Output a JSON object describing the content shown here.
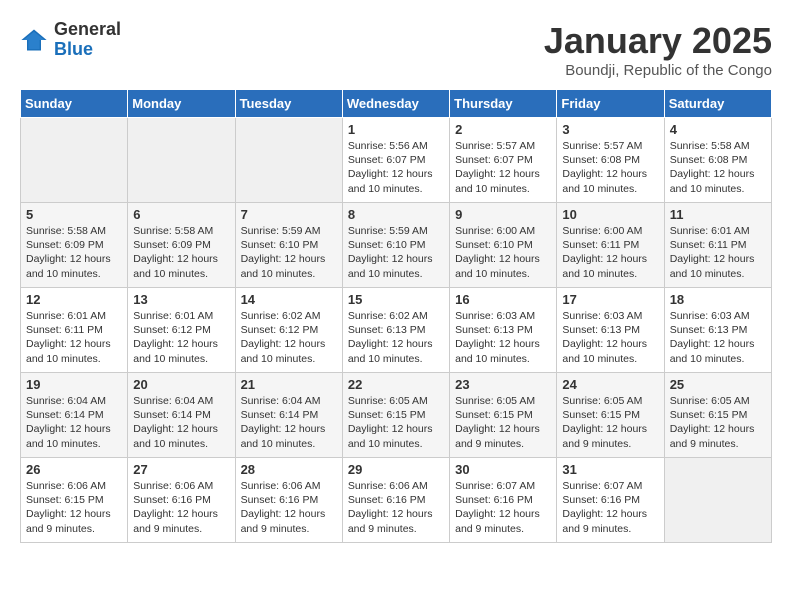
{
  "header": {
    "logo_general": "General",
    "logo_blue": "Blue",
    "month_title": "January 2025",
    "location": "Boundji, Republic of the Congo"
  },
  "days_of_week": [
    "Sunday",
    "Monday",
    "Tuesday",
    "Wednesday",
    "Thursday",
    "Friday",
    "Saturday"
  ],
  "weeks": [
    [
      {
        "day": "",
        "info": ""
      },
      {
        "day": "",
        "info": ""
      },
      {
        "day": "",
        "info": ""
      },
      {
        "day": "1",
        "info": "Sunrise: 5:56 AM\nSunset: 6:07 PM\nDaylight: 12 hours and 10 minutes."
      },
      {
        "day": "2",
        "info": "Sunrise: 5:57 AM\nSunset: 6:07 PM\nDaylight: 12 hours and 10 minutes."
      },
      {
        "day": "3",
        "info": "Sunrise: 5:57 AM\nSunset: 6:08 PM\nDaylight: 12 hours and 10 minutes."
      },
      {
        "day": "4",
        "info": "Sunrise: 5:58 AM\nSunset: 6:08 PM\nDaylight: 12 hours and 10 minutes."
      }
    ],
    [
      {
        "day": "5",
        "info": "Sunrise: 5:58 AM\nSunset: 6:09 PM\nDaylight: 12 hours and 10 minutes."
      },
      {
        "day": "6",
        "info": "Sunrise: 5:58 AM\nSunset: 6:09 PM\nDaylight: 12 hours and 10 minutes."
      },
      {
        "day": "7",
        "info": "Sunrise: 5:59 AM\nSunset: 6:10 PM\nDaylight: 12 hours and 10 minutes."
      },
      {
        "day": "8",
        "info": "Sunrise: 5:59 AM\nSunset: 6:10 PM\nDaylight: 12 hours and 10 minutes."
      },
      {
        "day": "9",
        "info": "Sunrise: 6:00 AM\nSunset: 6:10 PM\nDaylight: 12 hours and 10 minutes."
      },
      {
        "day": "10",
        "info": "Sunrise: 6:00 AM\nSunset: 6:11 PM\nDaylight: 12 hours and 10 minutes."
      },
      {
        "day": "11",
        "info": "Sunrise: 6:01 AM\nSunset: 6:11 PM\nDaylight: 12 hours and 10 minutes."
      }
    ],
    [
      {
        "day": "12",
        "info": "Sunrise: 6:01 AM\nSunset: 6:11 PM\nDaylight: 12 hours and 10 minutes."
      },
      {
        "day": "13",
        "info": "Sunrise: 6:01 AM\nSunset: 6:12 PM\nDaylight: 12 hours and 10 minutes."
      },
      {
        "day": "14",
        "info": "Sunrise: 6:02 AM\nSunset: 6:12 PM\nDaylight: 12 hours and 10 minutes."
      },
      {
        "day": "15",
        "info": "Sunrise: 6:02 AM\nSunset: 6:13 PM\nDaylight: 12 hours and 10 minutes."
      },
      {
        "day": "16",
        "info": "Sunrise: 6:03 AM\nSunset: 6:13 PM\nDaylight: 12 hours and 10 minutes."
      },
      {
        "day": "17",
        "info": "Sunrise: 6:03 AM\nSunset: 6:13 PM\nDaylight: 12 hours and 10 minutes."
      },
      {
        "day": "18",
        "info": "Sunrise: 6:03 AM\nSunset: 6:13 PM\nDaylight: 12 hours and 10 minutes."
      }
    ],
    [
      {
        "day": "19",
        "info": "Sunrise: 6:04 AM\nSunset: 6:14 PM\nDaylight: 12 hours and 10 minutes."
      },
      {
        "day": "20",
        "info": "Sunrise: 6:04 AM\nSunset: 6:14 PM\nDaylight: 12 hours and 10 minutes."
      },
      {
        "day": "21",
        "info": "Sunrise: 6:04 AM\nSunset: 6:14 PM\nDaylight: 12 hours and 10 minutes."
      },
      {
        "day": "22",
        "info": "Sunrise: 6:05 AM\nSunset: 6:15 PM\nDaylight: 12 hours and 10 minutes."
      },
      {
        "day": "23",
        "info": "Sunrise: 6:05 AM\nSunset: 6:15 PM\nDaylight: 12 hours and 9 minutes."
      },
      {
        "day": "24",
        "info": "Sunrise: 6:05 AM\nSunset: 6:15 PM\nDaylight: 12 hours and 9 minutes."
      },
      {
        "day": "25",
        "info": "Sunrise: 6:05 AM\nSunset: 6:15 PM\nDaylight: 12 hours and 9 minutes."
      }
    ],
    [
      {
        "day": "26",
        "info": "Sunrise: 6:06 AM\nSunset: 6:15 PM\nDaylight: 12 hours and 9 minutes."
      },
      {
        "day": "27",
        "info": "Sunrise: 6:06 AM\nSunset: 6:16 PM\nDaylight: 12 hours and 9 minutes."
      },
      {
        "day": "28",
        "info": "Sunrise: 6:06 AM\nSunset: 6:16 PM\nDaylight: 12 hours and 9 minutes."
      },
      {
        "day": "29",
        "info": "Sunrise: 6:06 AM\nSunset: 6:16 PM\nDaylight: 12 hours and 9 minutes."
      },
      {
        "day": "30",
        "info": "Sunrise: 6:07 AM\nSunset: 6:16 PM\nDaylight: 12 hours and 9 minutes."
      },
      {
        "day": "31",
        "info": "Sunrise: 6:07 AM\nSunset: 6:16 PM\nDaylight: 12 hours and 9 minutes."
      },
      {
        "day": "",
        "info": ""
      }
    ]
  ]
}
